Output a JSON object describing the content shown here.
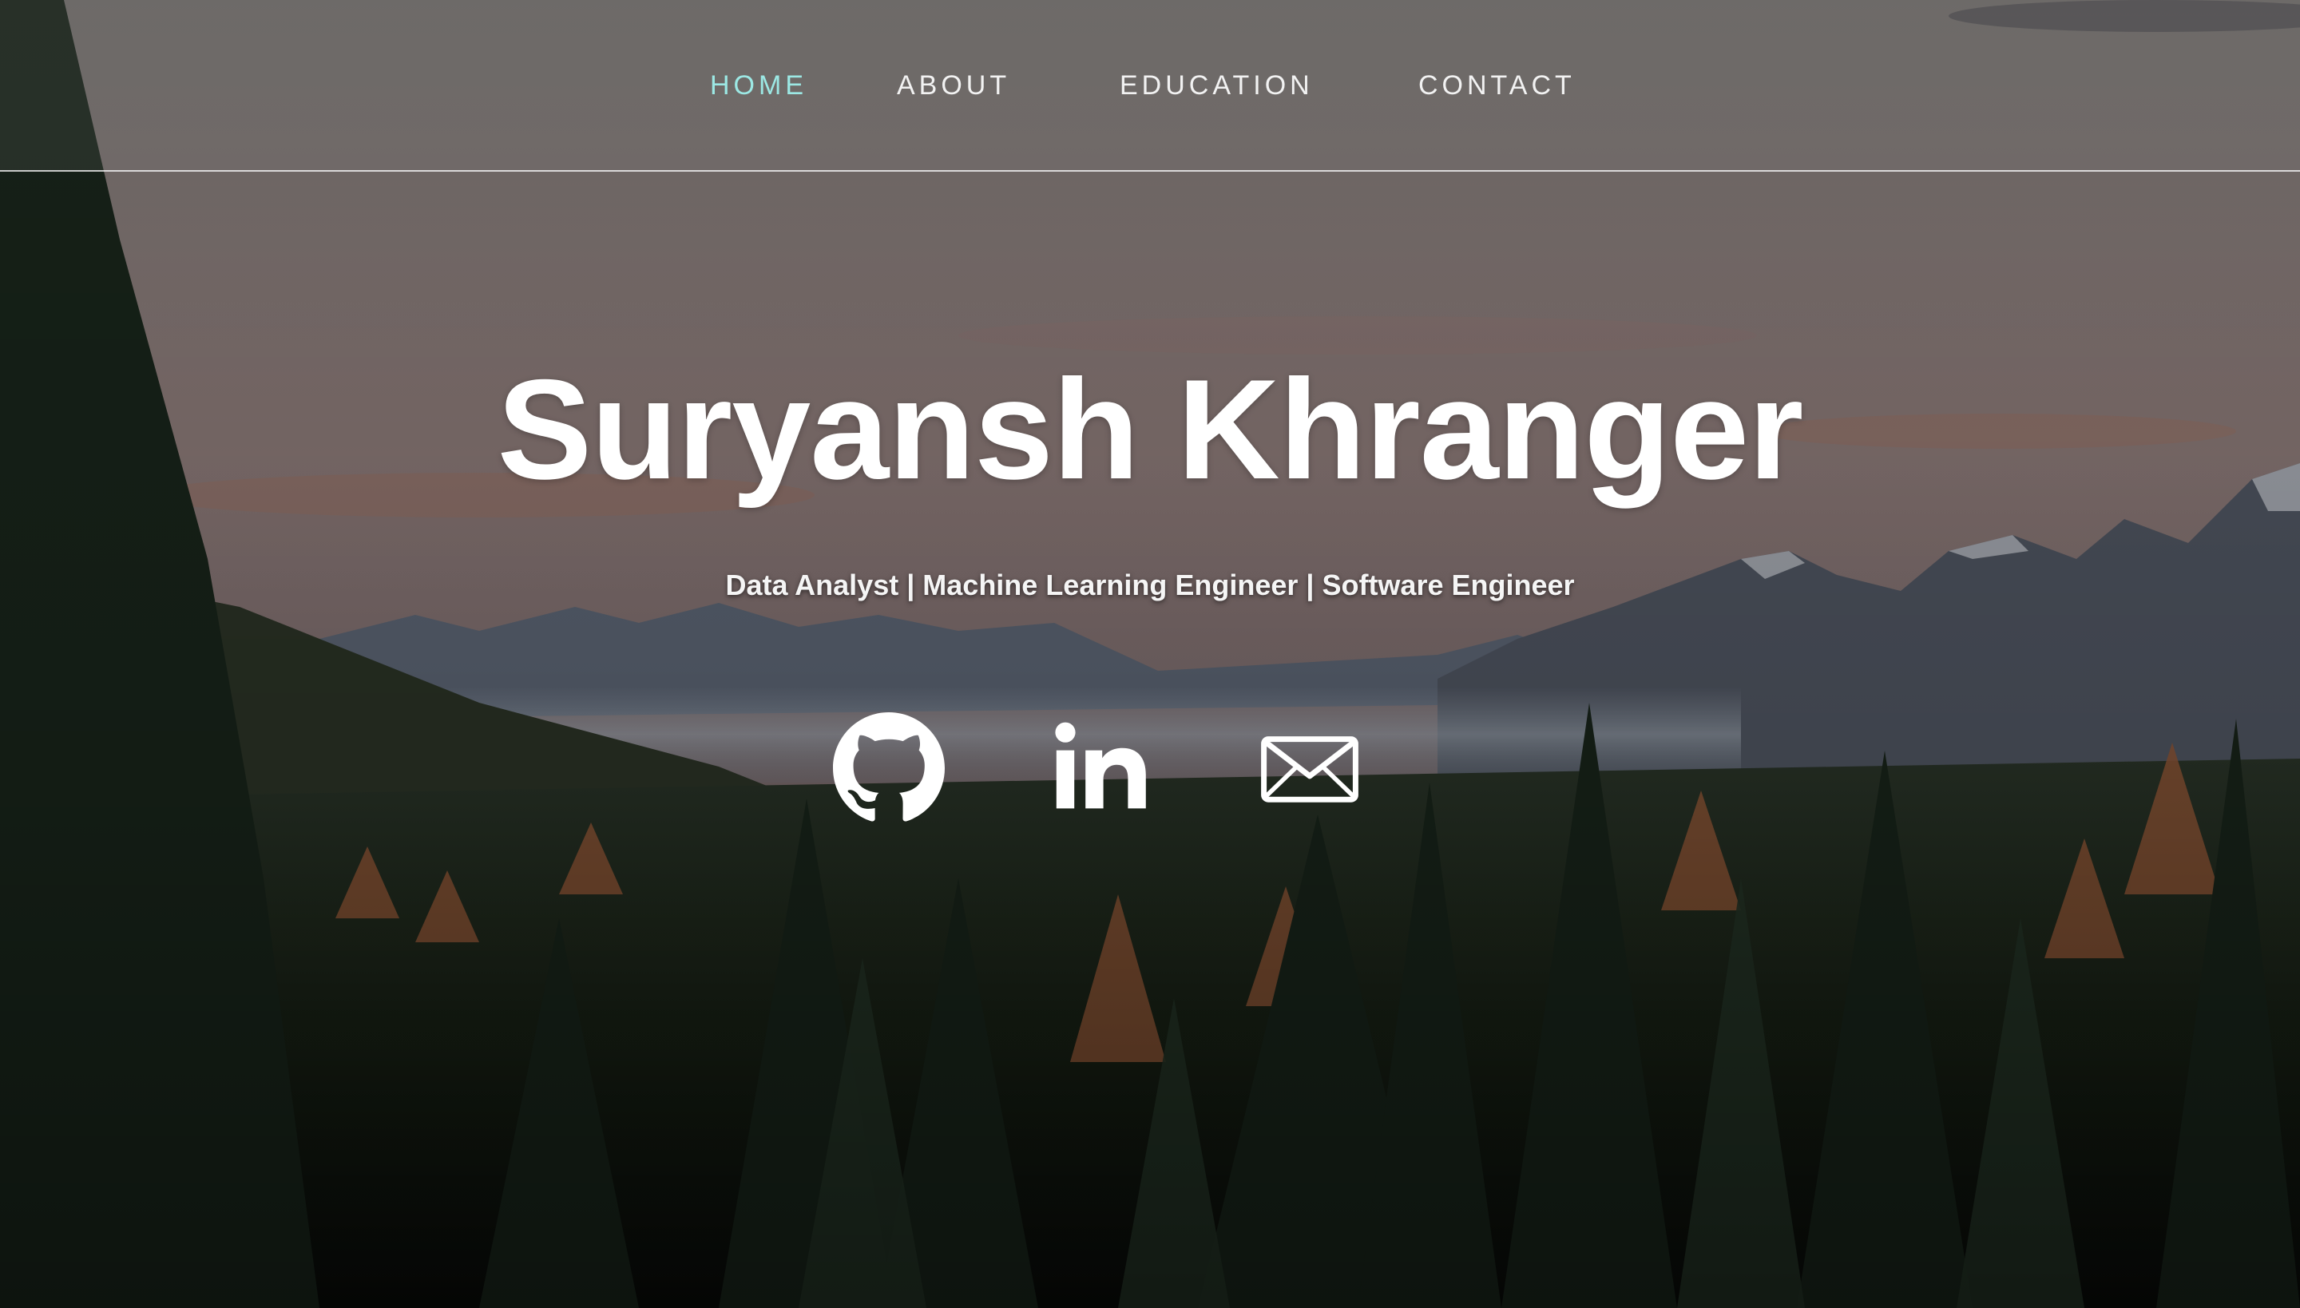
{
  "nav": {
    "items": [
      {
        "label": "HOME",
        "active": true
      },
      {
        "label": "ABOUT",
        "active": false
      },
      {
        "label": "EDUCATION",
        "active": false
      },
      {
        "label": "CONTACT",
        "active": false
      }
    ],
    "active_color": "#9ce8e4",
    "text_color": "#f2f2f2"
  },
  "hero": {
    "name": "Suryansh Khranger",
    "tagline": "Data Analyst | Machine Learning Engineer | Software Engineer"
  },
  "social": {
    "items": [
      {
        "icon": "github-icon"
      },
      {
        "icon": "linkedin-icon"
      },
      {
        "icon": "envelope-icon"
      }
    ]
  },
  "background": {
    "description_colors": {
      "sky": "#8a7a78",
      "mountains": "#4e5560",
      "forest": "#1e2a1e",
      "autumn_trees": "#9a5a38"
    }
  }
}
